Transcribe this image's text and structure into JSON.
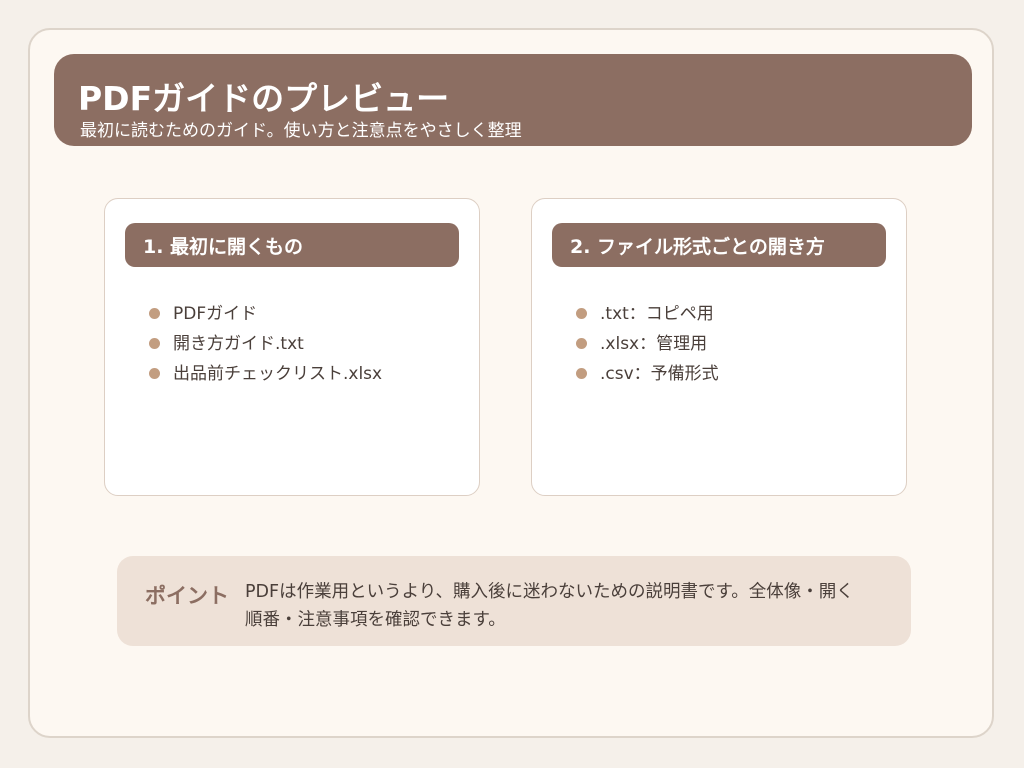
{
  "header": {
    "title": "PDFガイドのプレビュー",
    "subtitle": "最初に読むためのガイド。使い方と注意点をやさしく整理"
  },
  "cards": [
    {
      "title": "1. 最初に開くもの",
      "items": [
        "PDFガイド",
        "開き方ガイド.txt",
        "出品前チェックリスト.xlsx"
      ]
    },
    {
      "title": "2. ファイル形式ごとの開き方",
      "items": [
        ".txt：コピペ用",
        ".xlsx：管理用",
        ".csv：予備形式"
      ]
    }
  ],
  "point": {
    "label": "ポイント",
    "text": "PDFは作業用というより、購入後に迷わないための説明書です。全体像・開く順番・注意事項を確認できます。"
  },
  "colors": {
    "accent": "#8c6e62",
    "background": "#f5f0ea",
    "page": "#fdf8f2",
    "bullet": "#c29d80",
    "point_bg": "#eee1d7"
  }
}
